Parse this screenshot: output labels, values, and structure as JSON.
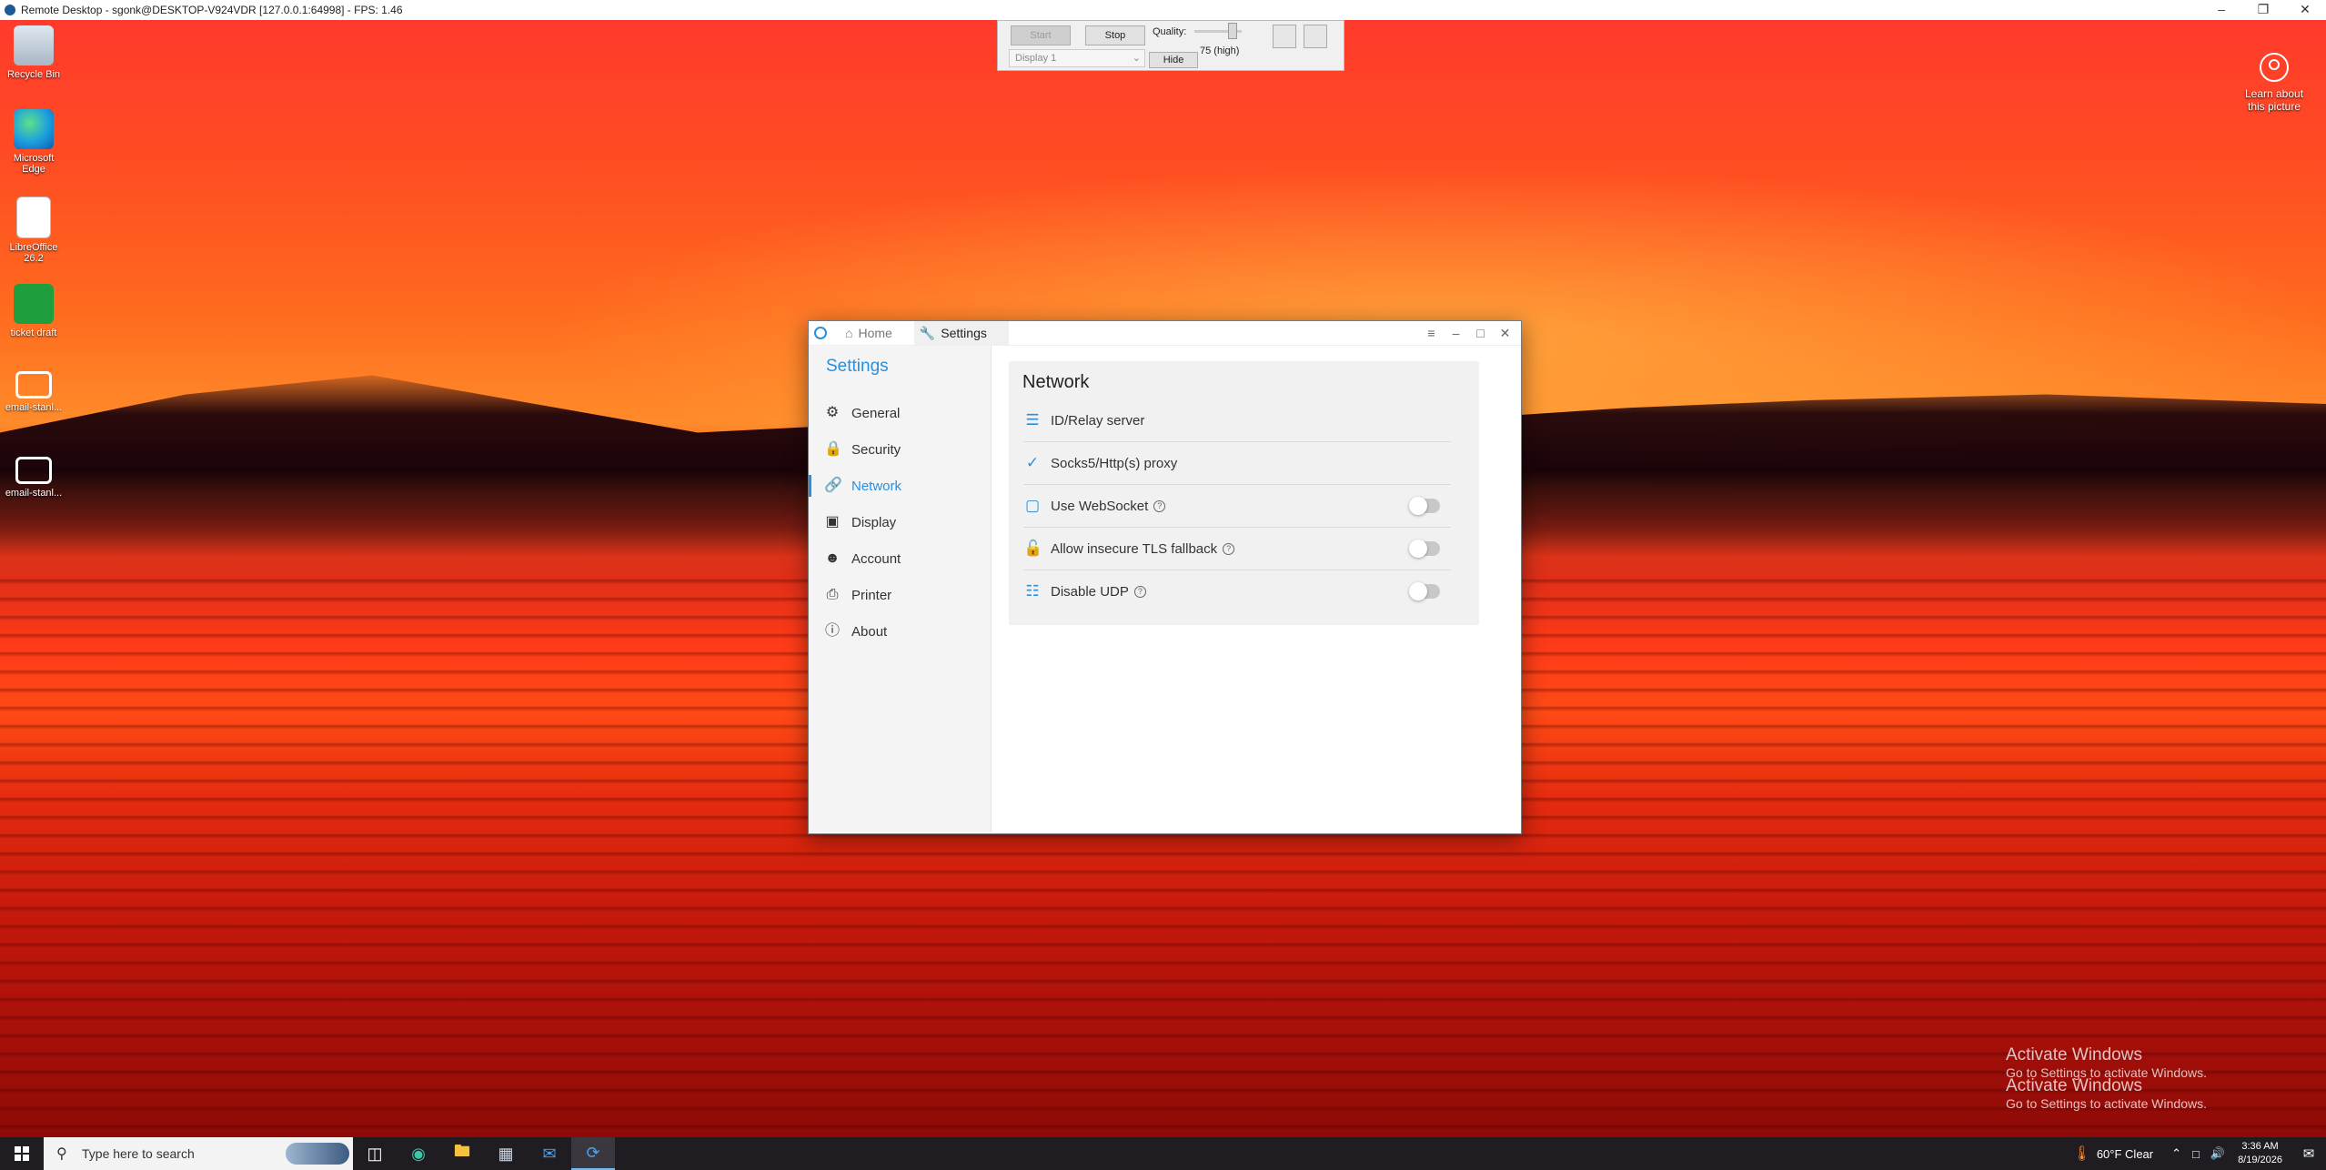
{
  "outer": {
    "title": "Remote Desktop - sgonk@DESKTOP-V924VDR [127.0.0.1:64998] - FPS: 1.46",
    "min_icon": "minimize-icon",
    "restore_icon": "restore-icon",
    "close_icon": "close-icon"
  },
  "rd_bar": {
    "start": "Start",
    "stop": "Stop",
    "quality_label": "Quality:",
    "quality_value": "75 (high)",
    "display_select": "Display 1",
    "hide": "Hide"
  },
  "desktop": {
    "icons": [
      {
        "label": "Recycle Bin",
        "icon": "recycle-bin-icon"
      },
      {
        "label": "Microsoft Edge",
        "icon": "edge-icon"
      },
      {
        "label": "LibreOffice 26.2",
        "icon": "document-icon"
      },
      {
        "label": "ticket draft",
        "icon": "spreadsheet-icon"
      },
      {
        "label": "email-stanl...",
        "icon": "mail-icon"
      },
      {
        "label": "email-stanl...",
        "icon": "mail-icon"
      }
    ],
    "learn_about": "Learn about this picture",
    "activate_title": "Activate Windows",
    "activate_sub": "Go to Settings to activate Windows."
  },
  "window": {
    "tabs": [
      {
        "label": "Home",
        "icon": "home-icon"
      },
      {
        "label": "Settings",
        "icon": "wrench-icon"
      }
    ],
    "sidebar_title": "Settings",
    "nav": [
      {
        "label": "General",
        "icon": "gear-icon"
      },
      {
        "label": "Security",
        "icon": "lock-icon"
      },
      {
        "label": "Network",
        "icon": "link-icon",
        "active": true
      },
      {
        "label": "Display",
        "icon": "monitor-icon"
      },
      {
        "label": "Account",
        "icon": "user-icon"
      },
      {
        "label": "Printer",
        "icon": "printer-icon"
      },
      {
        "label": "About",
        "icon": "info-icon"
      }
    ],
    "section_title": "Network",
    "rows": [
      {
        "label": "ID/Relay server",
        "icon": "server-icon"
      },
      {
        "label": "Socks5/Http(s) proxy",
        "icon": "proxy-icon"
      },
      {
        "label": "Use WebSocket",
        "icon": "window-icon",
        "toggle": false
      },
      {
        "label": "Allow insecure TLS fallback",
        "icon": "tls-icon",
        "toggle": false
      },
      {
        "label": "Disable UDP",
        "icon": "network-tree-icon",
        "toggle": false
      }
    ]
  },
  "taskbar": {
    "search_placeholder": "Type here to search",
    "weather": "60°F  Clear",
    "time": "3:36 AM",
    "date": "8/19/2026"
  },
  "colors": {
    "accent": "#2a8fdc",
    "taskbar": "#1f1d22"
  }
}
